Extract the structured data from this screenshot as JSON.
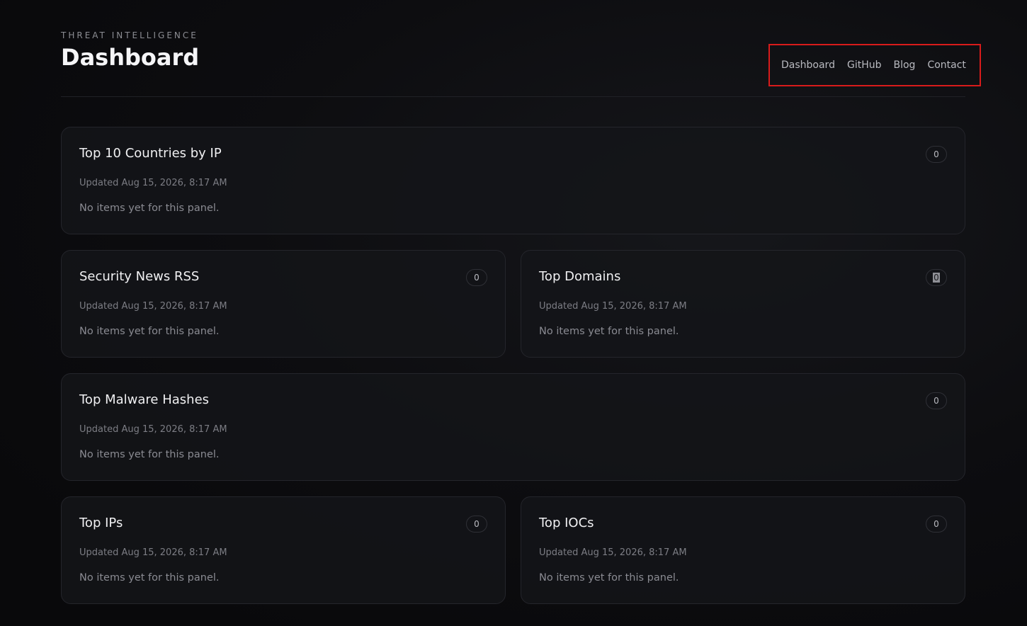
{
  "header": {
    "eyebrow": "THREAT INTELLIGENCE",
    "title": "Dashboard"
  },
  "nav": {
    "items": [
      {
        "label": "Dashboard"
      },
      {
        "label": "GitHub"
      },
      {
        "label": "Blog"
      },
      {
        "label": "Contact"
      }
    ],
    "highlight_color": "#d81b1b"
  },
  "panels": [
    {
      "title": "Top 10 Countries by IP",
      "updated": "Updated Aug 15, 2026, 8:17 AM",
      "empty_text": "No items yet for this panel.",
      "count": "0"
    },
    {
      "title": "Security News RSS",
      "updated": "Updated Aug 15, 2026, 8:17 AM",
      "empty_text": "No items yet for this panel.",
      "count": "0"
    },
    {
      "title": "Top Domains",
      "updated": "Updated Aug 15, 2026, 8:17 AM",
      "empty_text": "No items yet for this panel.",
      "count": "0"
    },
    {
      "title": "Top Malware Hashes",
      "updated": "Updated Aug 15, 2026, 8:17 AM",
      "empty_text": "No items yet for this panel.",
      "count": "0"
    },
    {
      "title": "Top IPs",
      "updated": "Updated Aug 15, 2026, 8:17 AM",
      "empty_text": "No items yet for this panel.",
      "count": "0"
    },
    {
      "title": "Top IOCs",
      "updated": "Updated Aug 15, 2026, 8:17 AM",
      "empty_text": "No items yet for this panel.",
      "count": "0"
    }
  ],
  "colors": {
    "background": "#0b0b0d",
    "panel_border": "#24252b",
    "text_primary": "#f0f0f2",
    "text_muted": "#7c7d84"
  }
}
